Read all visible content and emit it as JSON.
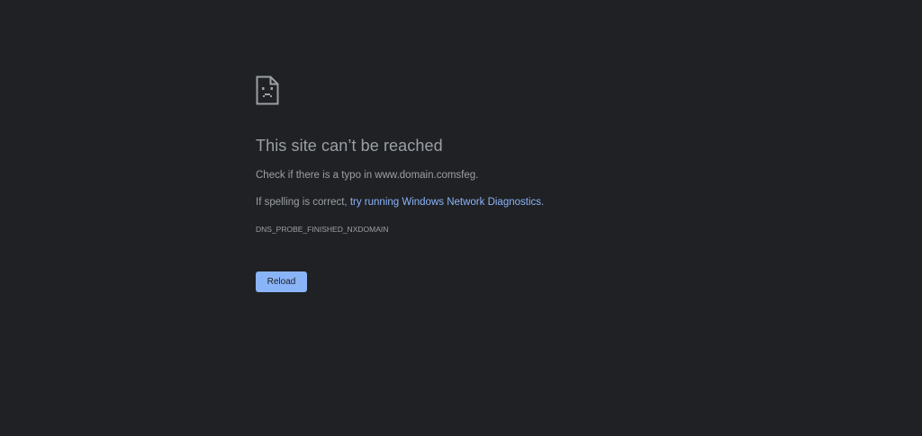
{
  "error": {
    "icon": "sad-document-icon",
    "title": "This site can’t be reached",
    "check_text": "Check if there is a typo in www.domain.comsfeg.",
    "spelling_prefix": "If spelling is correct, ",
    "diagnostics_link": "try running Windows Network Diagnostics",
    "spelling_suffix": ".",
    "code": "DNS_PROBE_FINISHED_NXDOMAIN",
    "reload_label": "Reload"
  },
  "colors": {
    "background": "#202124",
    "text": "#9aa0a6",
    "link": "#8ab4f8",
    "button": "#8ab4f8"
  }
}
